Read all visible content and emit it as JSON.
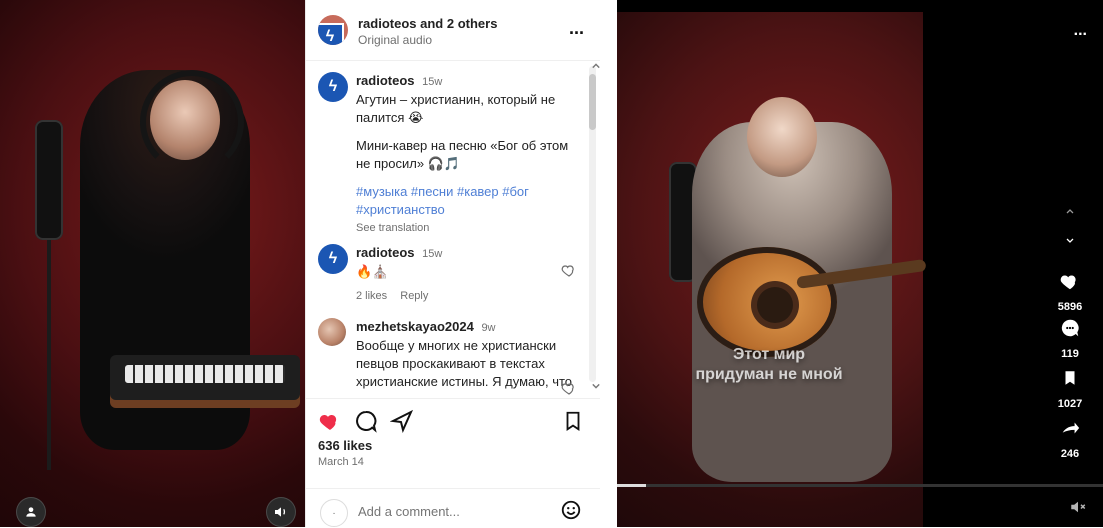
{
  "left_media": {
    "icons": {
      "user": "user-icon",
      "volume": "speaker-icon"
    }
  },
  "post": {
    "header": {
      "username": "radioteos",
      "others_suffix": " and 2 others",
      "audio": "Original audio",
      "more": "..."
    },
    "caption": {
      "user": "radioteos",
      "age": "15w",
      "line1": "Агутин – христианин, который не палится 😭",
      "line2": "Мини-кавер на песню «Бог об этом не просил» 🎧🎵",
      "hashtags": "#музыка #песни #кавер #бог #христианство",
      "see_translation": "See translation"
    },
    "comments": [
      {
        "user": "radioteos",
        "age": "15w",
        "text": "🔥⛪",
        "likes": "2 likes",
        "reply": "Reply"
      },
      {
        "user": "mezhetskayao2024",
        "age": "9w",
        "text": "Вообще у многих не христиански певцов проскакивают в текстах христианские истины. Я думаю, что просто душа знает своего"
      }
    ],
    "likes": "636 likes",
    "date": "March 14",
    "comment_placeholder": "Add a comment...",
    "colors": {
      "heart": "#ef2e4a",
      "hashtag": "#4f7fd5"
    }
  },
  "right_media": {
    "overlay_text": [
      "Этот мир",
      "придуман не мной"
    ],
    "more": "...",
    "likes_count": "5896",
    "comments_count": "119",
    "saves_count": "1027",
    "shares_count": "246",
    "progress": 0.06,
    "icons": [
      "chevron-up-icon",
      "chevron-down-icon",
      "heart-icon",
      "comment-icon",
      "bookmark-icon",
      "share-icon",
      "mute-icon"
    ]
  }
}
